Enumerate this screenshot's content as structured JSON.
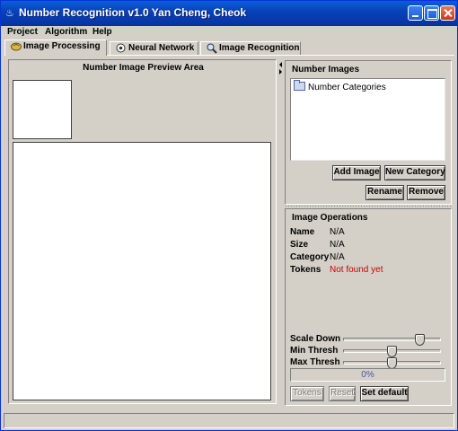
{
  "window": {
    "title": "Number Recognition v1.0 Yan Cheng, Cheok",
    "app_icon": "java-cup-icon"
  },
  "menu": [
    "Project",
    "Algorithm",
    "Help"
  ],
  "tabs": [
    {
      "label": "Image Processing",
      "icon": "image-icon",
      "active": true
    },
    {
      "label": "Neural Network",
      "icon": "network-icon",
      "active": false
    },
    {
      "label": "Image Recognition",
      "icon": "magnifier-icon",
      "active": false
    }
  ],
  "preview": {
    "title": "Number Image Preview Area"
  },
  "number_images": {
    "title": "Number Images",
    "tree_root": "Number Categories",
    "buttons": {
      "add_image": "Add Image",
      "new_category": "New Category",
      "rename": "Rename",
      "remove": "Remove"
    }
  },
  "image_operations": {
    "title": "Image Operations",
    "fields": [
      {
        "key": "Name",
        "value": "N/A"
      },
      {
        "key": "Size",
        "value": "N/A"
      },
      {
        "key": "Category",
        "value": "N/A"
      },
      {
        "key": "Tokens",
        "value": "Not found yet",
        "color": "#cc0000"
      }
    ],
    "sliders": [
      {
        "label": "Scale Down",
        "fraction": 0.82
      },
      {
        "label": "Min Thresh",
        "fraction": 0.5
      },
      {
        "label": "Max Thresh",
        "fraction": 0.5
      }
    ],
    "progress": {
      "percent": 0,
      "text": "0%"
    },
    "buttons": {
      "tokens": "Tokens",
      "reset": "Reset",
      "set_default": "Set default"
    }
  }
}
